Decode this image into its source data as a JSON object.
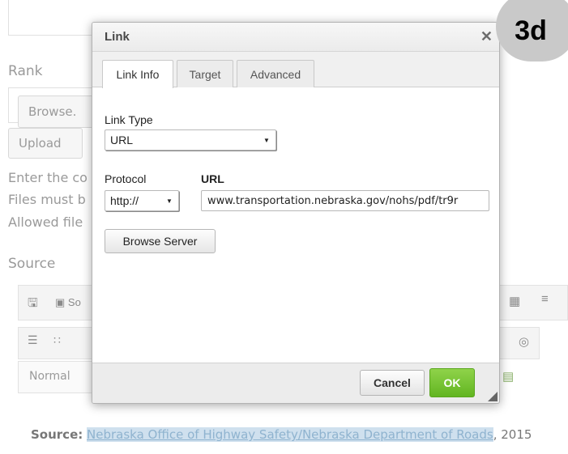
{
  "background": {
    "rank_label": "Rank",
    "browse_label": "Browse.",
    "upload_label": "Upload",
    "help_lines": [
      "Enter the co",
      "Files must b",
      "Allowed file"
    ],
    "source_label": "Source",
    "toolbar_source_label": "So",
    "format_select": "Normal",
    "source_caption": {
      "label": "Source:",
      "link": "Nebraska Office of Highway Safety/Nebraska Department of Roads",
      "year": ", 2015"
    }
  },
  "dialog": {
    "title": "Link",
    "close_glyph": "✕",
    "tabs": [
      {
        "label": "Link Info",
        "active": true
      },
      {
        "label": "Target",
        "active": false
      },
      {
        "label": "Advanced",
        "active": false
      }
    ],
    "link_type": {
      "label": "Link Type",
      "value": "URL"
    },
    "protocol": {
      "label": "Protocol",
      "value": "http://"
    },
    "url": {
      "label": "URL",
      "value": "www.transportation.nebraska.gov/nohs/pdf/tr9r"
    },
    "browse_server_label": "Browse Server",
    "cancel_label": "Cancel",
    "ok_label": "OK"
  },
  "step_badge": "3d",
  "colors": {
    "ok_green": "#62b521",
    "link_blue": "#8fb3cf"
  }
}
